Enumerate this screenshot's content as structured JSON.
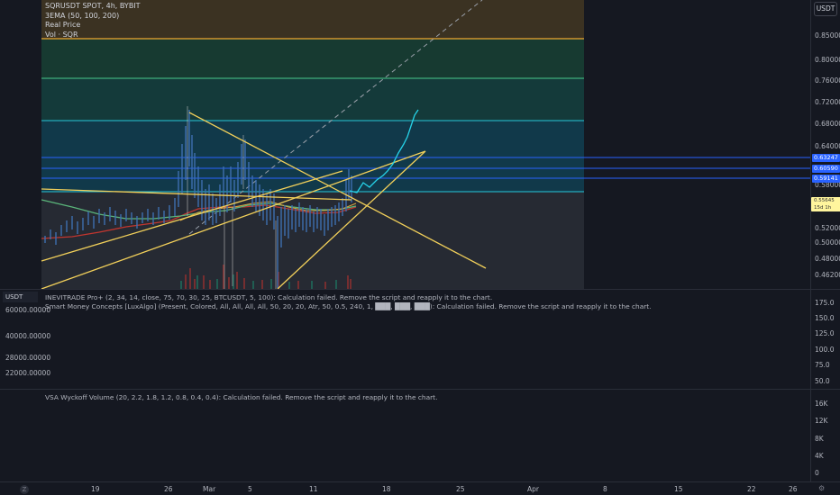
{
  "header": {
    "symbol_line": "SQRUSDT SPOT, 4h, BYBIT",
    "ema_line": "3EMA (50, 100, 200)",
    "real_price_line": "Real Price",
    "vol_line": "Vol · SQR"
  },
  "currency_button": "USDT",
  "price_axis": {
    "ticks": [
      "0.85000",
      "0.80000",
      "0.76000",
      "0.72000",
      "0.68000",
      "0.64000",
      "0.58000",
      "0.52000",
      "0.50000",
      "0.48000",
      "0.46200"
    ],
    "highlight_tags": [
      {
        "label": "0.63247",
        "color": "#2962ff"
      },
      {
        "label": "0.60590",
        "color": "#2962ff"
      },
      {
        "label": "0.59141",
        "color": "#2962ff"
      }
    ],
    "current_box_line1": "0.55645",
    "current_box_line2": "15d 1h"
  },
  "pane2": {
    "currency_label": "USDT",
    "msg1": "INEVITRADE Pro+ (2, 34, 14, close, 75, 70, 30, 25, BTCUSDT, 5, 100): Calculation failed. Remove the script and reapply it to the chart.",
    "msg2": "Smart Money Concepts [LuxAlgo] (Present, Colored, All, All, All, All, 50, 20, 20, Atr, 50, 0.5, 240, 1, ███, ███, ███): Calculation failed. Remove the script and reapply it to the chart.",
    "left_ticks": [
      "60000.00000",
      "40000.00000",
      "28000.00000",
      "22000.00000"
    ],
    "right_ticks": [
      "175.0",
      "150.0",
      "125.0",
      "100.0",
      "75.0",
      "50.0"
    ]
  },
  "pane3": {
    "msg": "VSA Wyckoff Volume (20, 2.2, 1.8, 1.2, 0.8, 0.4, 0.4): Calculation failed. Remove the script and reapply it to the chart.",
    "right_ticks": [
      "16K",
      "12K",
      "8K",
      "4K",
      "0"
    ]
  },
  "time_axis": {
    "ticks": [
      "19",
      "26",
      "Mar",
      "5",
      "11",
      "18",
      "25",
      "Apr",
      "8",
      "15",
      "22",
      "26"
    ]
  },
  "zoom_label": "Z",
  "colors": {
    "background": "#151821",
    "orange_zone": "#3d3420",
    "green_zone": "#16352e",
    "teal_zone": "#0f3a43",
    "gray_zone": "#272a33",
    "orange_line": "#f0a830",
    "green_line": "#49c98a",
    "cyan_line": "#26c6da",
    "trend_line": "#f2d05a",
    "blue_level": "#2962ff",
    "prediction": "#26d3e8"
  }
}
